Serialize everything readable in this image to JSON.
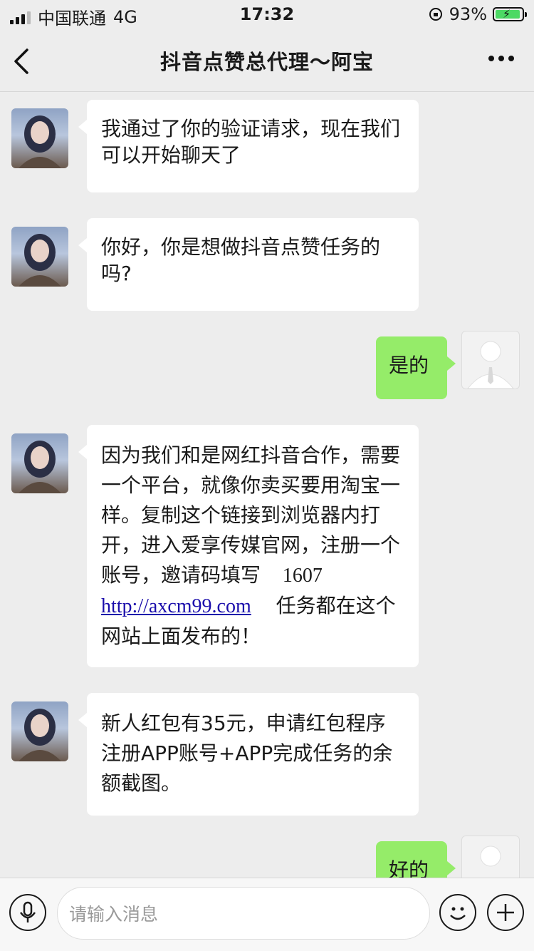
{
  "status_bar": {
    "carrier": "中国联通",
    "network": "4G",
    "time": "17:32",
    "battery_percent": "93%",
    "battery_level": 0.93
  },
  "nav": {
    "title": "抖音点赞总代理～阿宝"
  },
  "messages": [
    {
      "side": "left",
      "text": "我通过了你的验证请求，现在我们可以开始聊天了"
    },
    {
      "side": "left",
      "text": "你好，你是想做抖音点赞任务的吗?"
    },
    {
      "side": "right",
      "text": "是的"
    },
    {
      "side": "left",
      "text_part1": "因为我们和是网红抖音合作，需要一个平台，就像你卖买要用淘宝一样。复制这个链接到浏览器内打开，进入爱享传媒官网，注册一个账号，邀请码填写",
      "invite_code": "1607",
      "link": "http://axcm99.com",
      "text_part2": "任务都在这个网站上面发布的！"
    },
    {
      "side": "left",
      "text": "新人红包有35元，申请红包程序注册APP账号+APP完成任务的余额截图。"
    },
    {
      "side": "right",
      "text": "好的"
    }
  ],
  "input": {
    "placeholder": "请输入消息"
  },
  "icons": {
    "back": "chevron-left-icon",
    "more": "more-dots-icon",
    "voice": "microphone-icon",
    "emoji": "smiley-icon",
    "add": "plus-icon"
  },
  "colors": {
    "background": "#ededed",
    "bubble_self": "#95ec69",
    "bubble_other": "#ffffff",
    "link": "#1a0dab"
  }
}
